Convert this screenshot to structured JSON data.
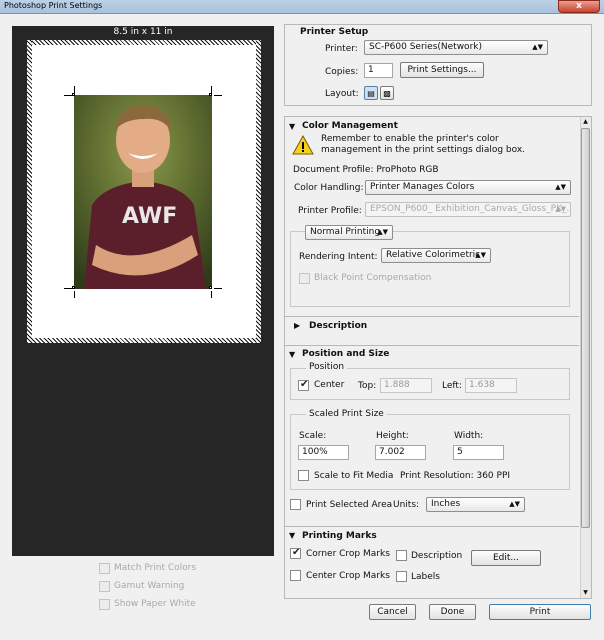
{
  "window": {
    "title": "Photoshop Print Settings",
    "close_glyph": "x"
  },
  "preview": {
    "paper_size": "8.5 in x 11 in",
    "options": [
      {
        "label": "Match Print Colors",
        "checked": false,
        "enabled": false
      },
      {
        "label": "Gamut Warning",
        "checked": false,
        "enabled": false
      },
      {
        "label": "Show Paper White",
        "checked": false,
        "enabled": false
      }
    ]
  },
  "printer_setup": {
    "title": "Printer Setup",
    "printer_label": "Printer:",
    "printer_value": "SC-P600 Series(Network)",
    "copies_label": "Copies:",
    "copies_value": "1",
    "print_settings_button": "Print Settings...",
    "layout_label": "Layout:",
    "layout_icons": [
      "portrait-layout-icon",
      "landscape-layout-icon"
    ]
  },
  "color_management": {
    "title": "Color Management",
    "warning_icon": "warning-icon",
    "warning_text_line1": "Remember to enable the printer's color",
    "warning_text_line2": "management in the print settings dialog box.",
    "doc_profile": "Document Profile: ProPhoto RGB",
    "color_handling_label": "Color Handling:",
    "color_handling_value": "Printer Manages Colors",
    "printer_profile_label": "Printer Profile:",
    "printer_profile_value": "EPSON_P600_ Exhibition_Canvas_Gloss_PK_...",
    "normal_printing": "Normal Printing",
    "rendering_intent_label": "Rendering Intent:",
    "rendering_intent_value": "Relative Colorimetric",
    "black_point": "Black Point Compensation"
  },
  "description": {
    "title": "Description"
  },
  "position_size": {
    "title": "Position and Size",
    "position_legend": "Position",
    "center_label": "Center",
    "center_checked": true,
    "top_label": "Top:",
    "top_value": "1.888",
    "left_label": "Left:",
    "left_value": "1.638",
    "scaled_legend": "Scaled Print Size",
    "scale_label": "Scale:",
    "scale_value": "100%",
    "height_label": "Height:",
    "height_value": "7.002",
    "width_label": "Width:",
    "width_value": "5",
    "scale_to_fit": "Scale to Fit Media",
    "print_resolution": "Print Resolution: 360 PPI",
    "print_selected_area": "Print Selected Area",
    "units_label": "Units:",
    "units_value": "Inches"
  },
  "printing_marks": {
    "title": "Printing Marks",
    "corner_crop": "Corner Crop Marks",
    "corner_crop_checked": true,
    "center_crop": "Center Crop Marks",
    "description": "Description",
    "labels": "Labels",
    "edit_button": "Edit..."
  },
  "footer": {
    "cancel": "Cancel",
    "done": "Done",
    "print": "Print"
  }
}
